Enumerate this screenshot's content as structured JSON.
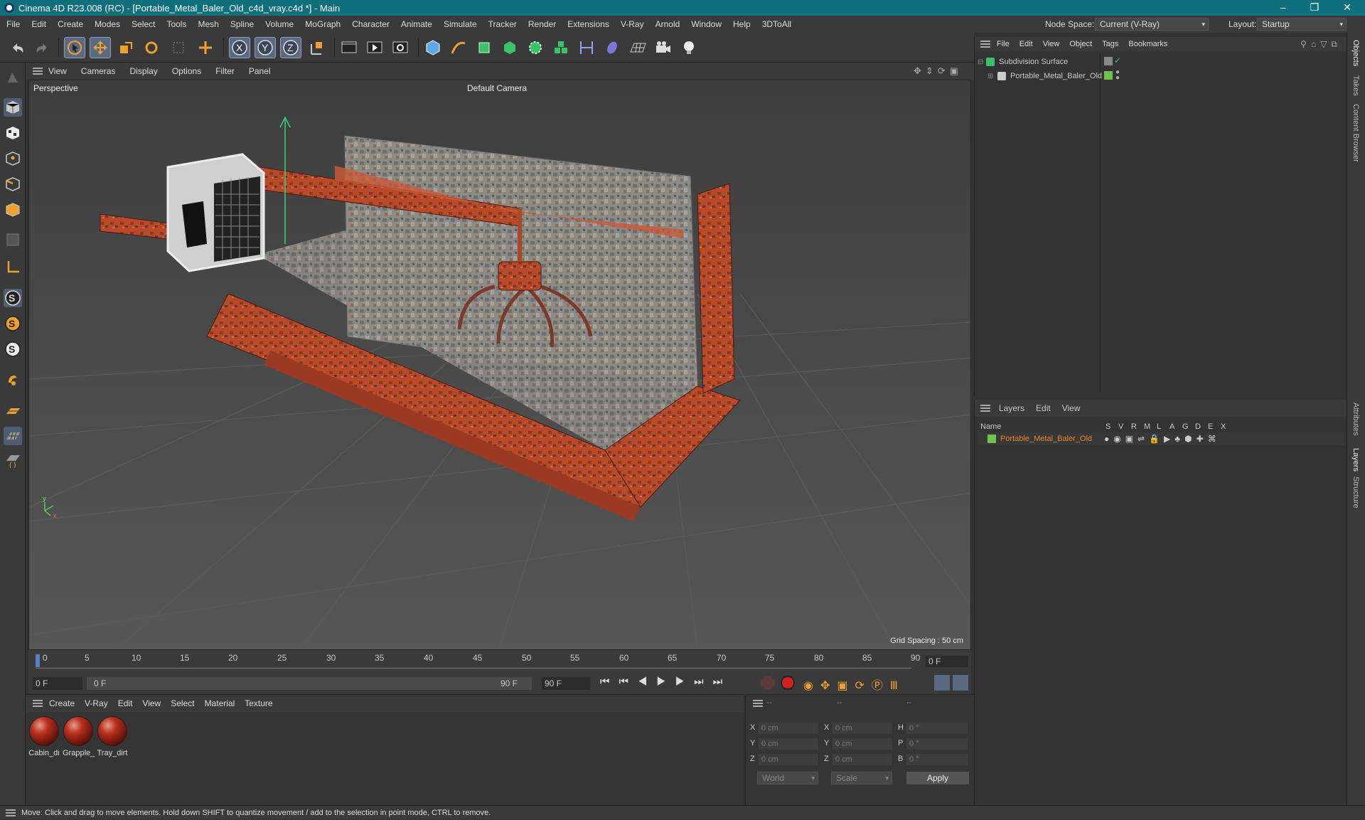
{
  "window": {
    "title": "Cinema 4D R23.008 (RC) - [Portable_Metal_Baler_Old_c4d_vray.c4d *] - Main"
  },
  "menubar": {
    "items": [
      "File",
      "Edit",
      "Create",
      "Modes",
      "Select",
      "Tools",
      "Mesh",
      "Spline",
      "Volume",
      "MoGraph",
      "Character",
      "Animate",
      "Simulate",
      "Tracker",
      "Render",
      "Extensions",
      "V-Ray",
      "Arnold",
      "Window",
      "Help",
      "3DToAll"
    ],
    "node_space_label": "Node Space:",
    "node_space_value": "Current (V-Ray)",
    "layout_label": "Layout:",
    "layout_value": "Startup"
  },
  "viewport": {
    "menu": [
      "View",
      "Cameras",
      "Display",
      "Options",
      "Filter",
      "Panel"
    ],
    "label": "Perspective",
    "camera": "Default Camera",
    "grid_spacing": "Grid Spacing : 50 cm"
  },
  "timeline": {
    "ticks": [
      "0",
      "5",
      "10",
      "15",
      "20",
      "25",
      "30",
      "35",
      "40",
      "45",
      "50",
      "55",
      "60",
      "65",
      "70",
      "75",
      "80",
      "85",
      "90"
    ],
    "current_frame": "0 F",
    "start_frame": "0 F",
    "range_start": "0 F",
    "range_end": "90 F",
    "end_frame": "90 F"
  },
  "materials": {
    "menu": [
      "Create",
      "V-Ray",
      "Edit",
      "View",
      "Select",
      "Material",
      "Texture"
    ],
    "items": [
      "Cabin_di",
      "Grapple_",
      "Tray_dirt"
    ]
  },
  "coords": {
    "headers": [
      "--",
      "--",
      "--"
    ],
    "rows": [
      {
        "a": "X",
        "av": "0 cm",
        "b": "X",
        "bv": "0 cm",
        "c": "H",
        "cv": "0 °"
      },
      {
        "a": "Y",
        "av": "0 cm",
        "b": "Y",
        "bv": "0 cm",
        "c": "P",
        "cv": "0 °"
      },
      {
        "a": "Z",
        "av": "0 cm",
        "b": "Z",
        "bv": "0 cm",
        "c": "B",
        "cv": "0 °"
      }
    ],
    "world": "World",
    "scale": "Scale",
    "apply": "Apply"
  },
  "objects": {
    "menu": [
      "File",
      "Edit",
      "View",
      "Object",
      "Tags",
      "Bookmarks"
    ],
    "items": [
      "Subdivision Surface",
      "Portable_Metal_Baler_Old"
    ]
  },
  "layers": {
    "menu": [
      "Layers",
      "Edit",
      "View"
    ],
    "name_header": "Name",
    "flags": [
      "S",
      "V",
      "R",
      "M",
      "L",
      "A",
      "G",
      "D",
      "E",
      "X"
    ],
    "item": "Portable_Metal_Baler_Old"
  },
  "right_tabs": [
    "Objects",
    "Takes",
    "Content Browser",
    "Attributes",
    "Layers",
    "Structure"
  ],
  "status": "Move: Click and drag to move elements. Hold down SHIFT to quantize movement / add to the selection in point mode, CTRL to remove.",
  "colors": {
    "titlebar": "#0f6f7a",
    "accent_orange": "#e8832a",
    "layer_green": "#6fc24a"
  }
}
